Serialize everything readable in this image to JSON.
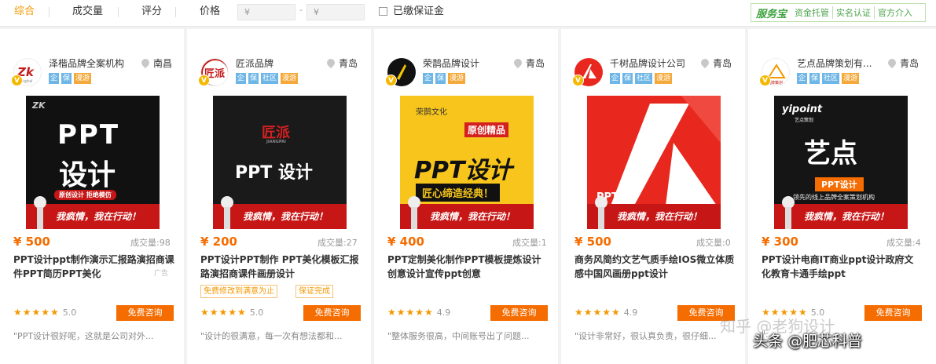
{
  "sort": {
    "comprehensive": "综合",
    "volume": "成交量",
    "rating": "评分",
    "price": "价格"
  },
  "price_filter": {
    "min_placeholder": "¥",
    "max_placeholder": "¥",
    "separator": "-"
  },
  "deposit_filter": {
    "label": "已缴保证金",
    "checked": false
  },
  "service_bar": {
    "logo": "服务宝",
    "items": [
      "资金托管",
      "实名认证",
      "官方介入"
    ]
  },
  "colors": {
    "accent": "#f39800",
    "price": "#f56c00",
    "button": "#f56c00",
    "tag_blue": "#6eb6e6",
    "tag_orange": "#f5a93a"
  },
  "cards": [
    {
      "shop": "泽楷品牌全案机构",
      "location": "南昌",
      "tags": [
        "企",
        "保",
        "漫游"
      ],
      "image": {
        "brand": "ZK",
        "line1": "PPT",
        "line2": "设计",
        "sub": "原创设计 拒绝模仿",
        "slogan": "我疯情，我在行动！"
      },
      "price": "¥ 500",
      "deals": "成交量:98",
      "title": "PPT设计ppt制作演示汇报路演招商课件PPT简历PPT美化",
      "ad": "广告",
      "promo_tags": [],
      "rating": "5.0",
      "stars": "★★★★★",
      "consult": "免费咨询",
      "review": "\"PPT设计很好呢，这就是公司对外..."
    },
    {
      "shop": "匠派品牌",
      "location": "青岛",
      "tags": [
        "企",
        "保",
        "社区",
        "漫游"
      ],
      "image": {
        "brand": "匠派",
        "brand_sub": "JIANGPAI",
        "line1": "PPT 设计",
        "slogan": "我疯情，我在行动！"
      },
      "price": "¥ 200",
      "deals": "成交量:27",
      "title": "PPT设计PPT制作 PPT美化模板汇报路演招商课件画册设计",
      "ad": "",
      "promo_tags": [
        "免费修改到满意为止",
        "保证完成"
      ],
      "rating": "5.0",
      "stars": "★★★★★",
      "consult": "免费咨询",
      "review": "\"设计的很满意，每一次有想法都和..."
    },
    {
      "shop": "荣鹊品牌设计",
      "location": "青岛",
      "tags": [
        "企",
        "保",
        "漫游"
      ],
      "image": {
        "brand": "荣鹊文化",
        "badge": "原创精品",
        "line1": "PPT设计",
        "sub": "匠心缔造经典！",
        "slogan": "我疯情，我在行动！"
      },
      "price": "¥ 400",
      "deals": "成交量:1",
      "title": "PPT定制美化制作PPT模板提炼设计创意设计宣传ppt创意",
      "ad": "",
      "promo_tags": [],
      "rating": "4.9",
      "stars": "★★★★★",
      "consult": "免费咨询",
      "review": "\"整体服务很高，中间账号出了问题..."
    },
    {
      "shop": "千树品牌设计公司",
      "location": "青岛",
      "tags": [
        "企",
        "保",
        "社区",
        "漫游"
      ],
      "image": {
        "line1": "PPT设计",
        "slogan": "我疯情，我在行动！"
      },
      "price": "¥ 500",
      "deals": "成交量:0",
      "title": "商务风简约文艺气质手绘IOS微立体质感中国风画册ppt设计",
      "ad": "",
      "promo_tags": [],
      "rating": "4.9",
      "stars": "★★★★★",
      "consult": "免费咨询",
      "review": "\"设计非常好，很认真负责，很仔细..."
    },
    {
      "shop": "艺点品牌策划有...",
      "location": "青岛",
      "tags": [
        "企",
        "保",
        "社区",
        "漫游"
      ],
      "image": {
        "brand": "yipoint",
        "brand_sub": "艺点策划",
        "line1": "艺点",
        "badge": "PPT设计",
        "sub": "领先的线上品牌全案策划机构",
        "slogan": "我疯情，我在行动！"
      },
      "price": "¥ 300",
      "deals": "成交量:4",
      "title": "PPT设计电商IT商业ppt设计政府文化教育卡通手绘ppt",
      "ad": "",
      "promo_tags": [],
      "rating": "5.0",
      "stars": "★★★★★",
      "consult": "免费咨询",
      "review": "\"..."
    }
  ],
  "watermark": {
    "line1": "知乎 @老狗设计",
    "line2": "头条 @肥芯科普"
  }
}
